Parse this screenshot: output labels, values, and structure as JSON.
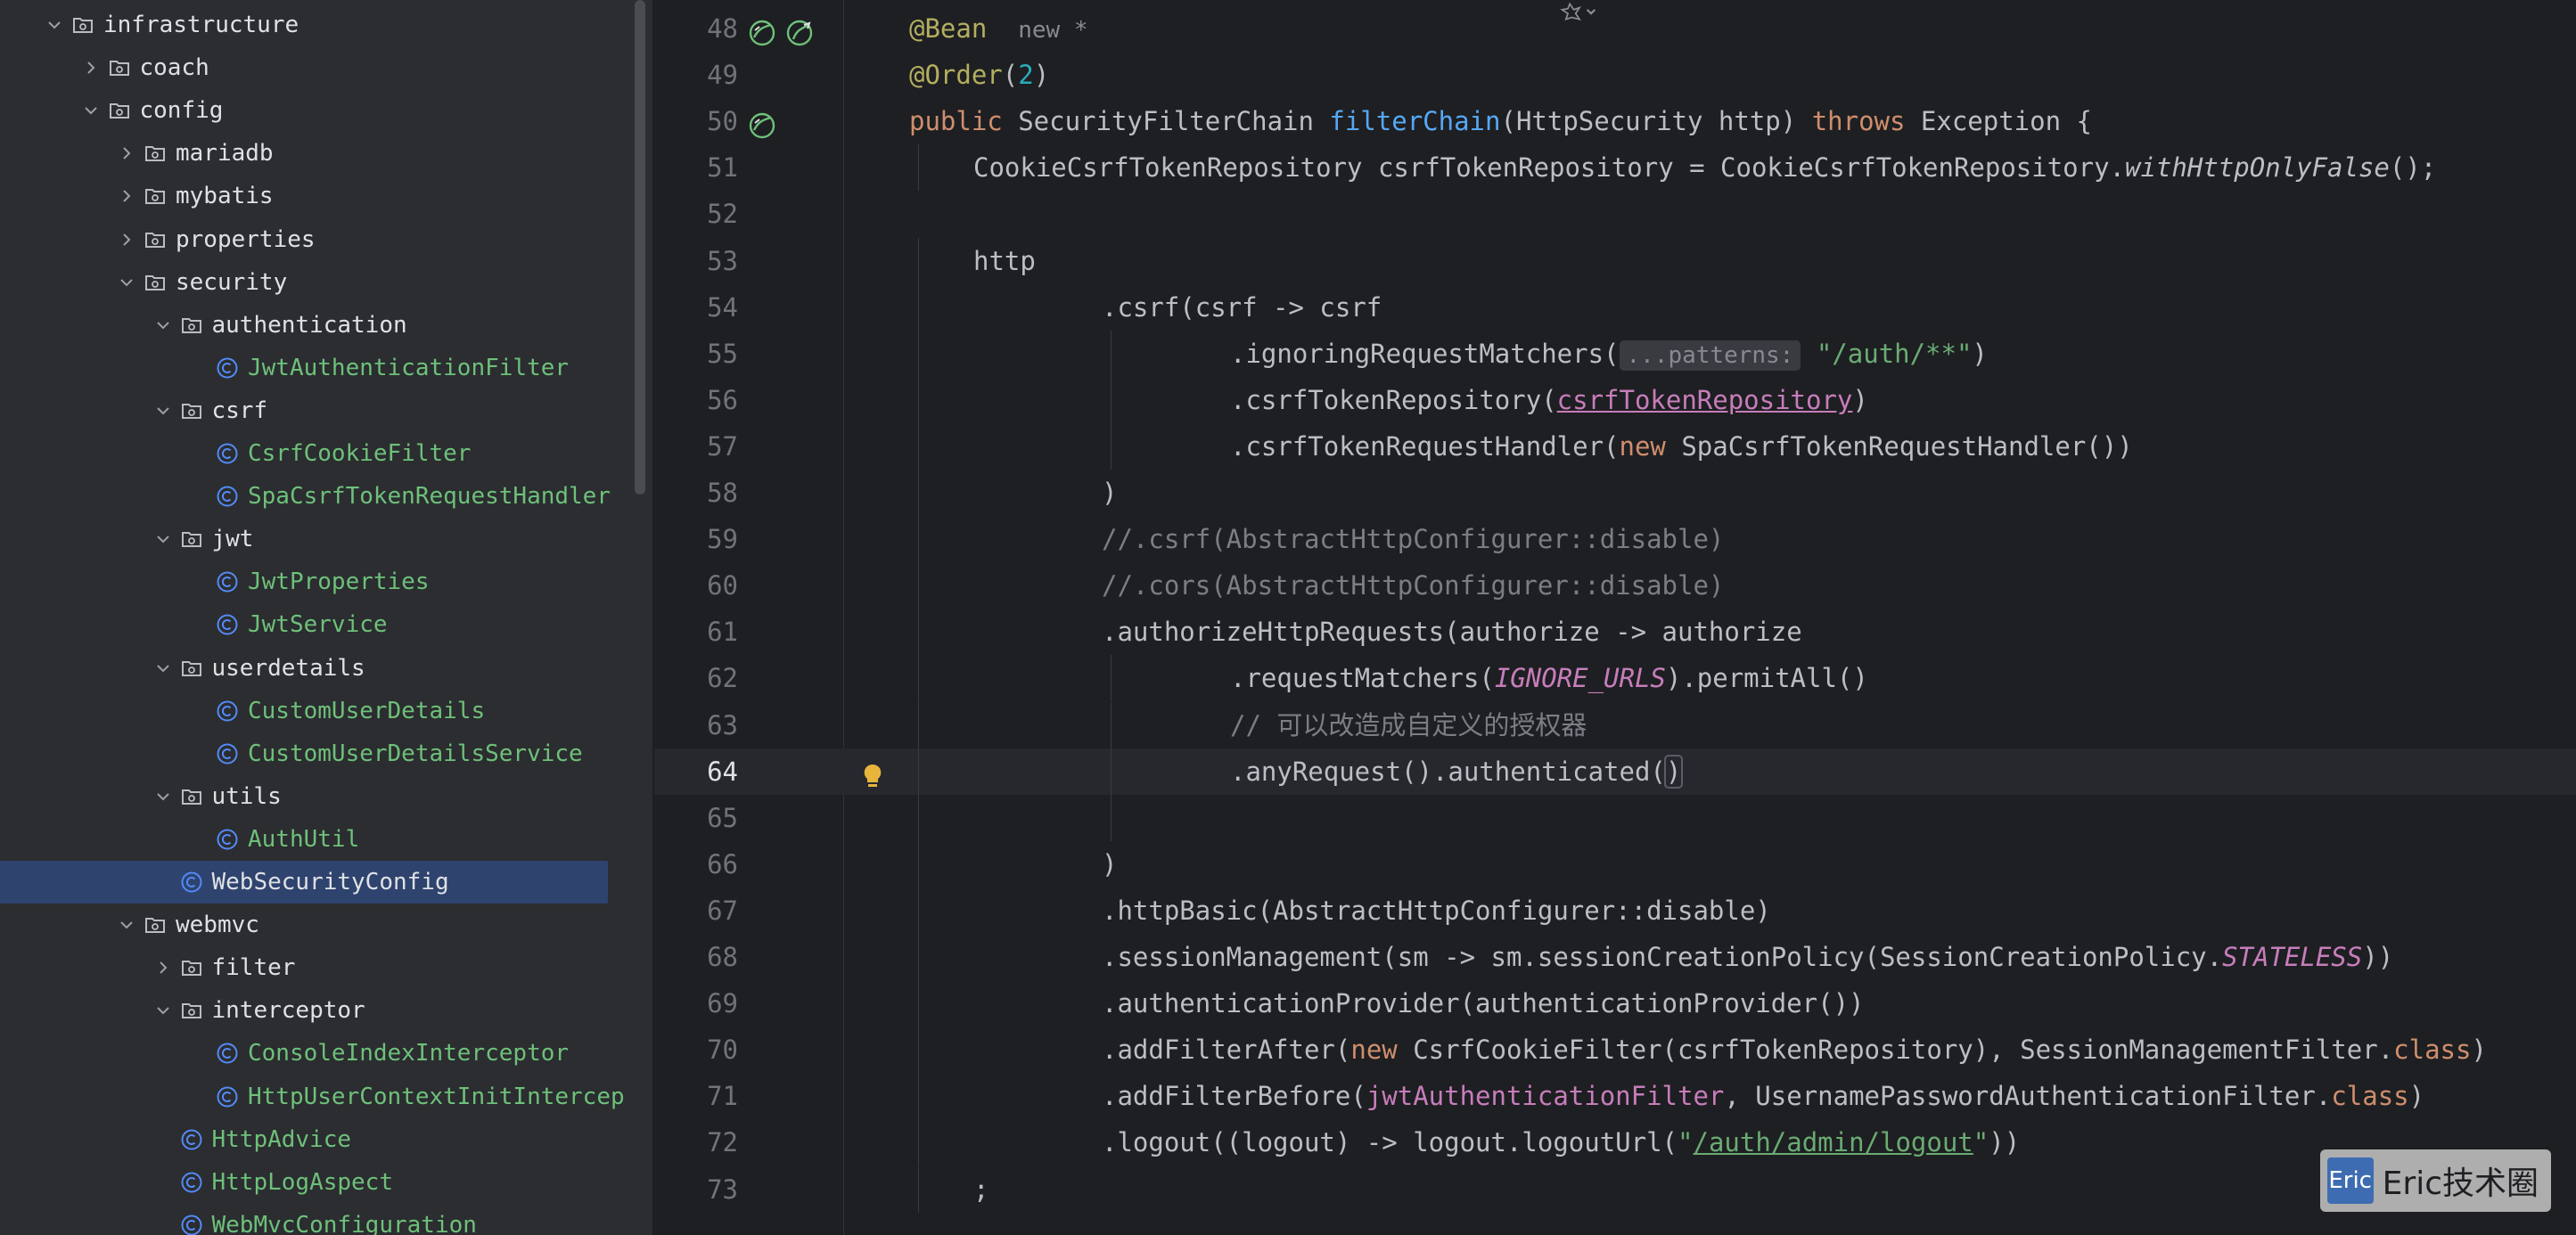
{
  "tree": [
    {
      "label": "infrastructure",
      "type": "folder",
      "depth": 0,
      "expanded": true
    },
    {
      "label": "coach",
      "type": "folder",
      "depth": 1,
      "expanded": false
    },
    {
      "label": "config",
      "type": "folder",
      "depth": 1,
      "expanded": true
    },
    {
      "label": "mariadb",
      "type": "folder",
      "depth": 2,
      "expanded": false
    },
    {
      "label": "mybatis",
      "type": "folder",
      "depth": 2,
      "expanded": false
    },
    {
      "label": "properties",
      "type": "folder",
      "depth": 2,
      "expanded": false
    },
    {
      "label": "security",
      "type": "folder",
      "depth": 2,
      "expanded": true
    },
    {
      "label": "authentication",
      "type": "folder",
      "depth": 3,
      "expanded": true
    },
    {
      "label": "JwtAuthenticationFilter",
      "type": "class",
      "depth": 4
    },
    {
      "label": "csrf",
      "type": "folder",
      "depth": 3,
      "expanded": true
    },
    {
      "label": "CsrfCookieFilter",
      "type": "class",
      "depth": 4
    },
    {
      "label": "SpaCsrfTokenRequestHandler",
      "type": "class",
      "depth": 4
    },
    {
      "label": "jwt",
      "type": "folder",
      "depth": 3,
      "expanded": true
    },
    {
      "label": "JwtProperties",
      "type": "class",
      "depth": 4
    },
    {
      "label": "JwtService",
      "type": "class",
      "depth": 4
    },
    {
      "label": "userdetails",
      "type": "folder",
      "depth": 3,
      "expanded": true
    },
    {
      "label": "CustomUserDetails",
      "type": "class",
      "depth": 4
    },
    {
      "label": "CustomUserDetailsService",
      "type": "class",
      "depth": 4
    },
    {
      "label": "utils",
      "type": "folder",
      "depth": 3,
      "expanded": true
    },
    {
      "label": "AuthUtil",
      "type": "class",
      "depth": 4
    },
    {
      "label": "WebSecurityConfig",
      "type": "class",
      "depth": 3,
      "selected": true
    },
    {
      "label": "webmvc",
      "type": "folder",
      "depth": 2,
      "expanded": true
    },
    {
      "label": "filter",
      "type": "folder",
      "depth": 3,
      "expanded": false
    },
    {
      "label": "interceptor",
      "type": "folder",
      "depth": 3,
      "expanded": true
    },
    {
      "label": "ConsoleIndexInterceptor",
      "type": "class",
      "depth": 4
    },
    {
      "label": "HttpUserContextInitIntercep",
      "type": "class",
      "depth": 4
    },
    {
      "label": "HttpAdvice",
      "type": "class",
      "depth": 3
    },
    {
      "label": "HttpLogAspect",
      "type": "class",
      "depth": 3
    },
    {
      "label": "WebMvcConfiguration",
      "type": "class",
      "depth": 3
    }
  ],
  "editor": {
    "current_line": "64",
    "lines": [
      {
        "n": "48",
        "indent": 0,
        "markers": [
          "bean-icon",
          "bean-override-icon"
        ],
        "tokens": [
          [
            "ann",
            "@Bean"
          ],
          [
            "plain",
            "  "
          ],
          [
            "hint",
            "new *"
          ]
        ]
      },
      {
        "n": "49",
        "indent": 0,
        "tokens": [
          [
            "ann",
            "@Order"
          ],
          [
            "plain",
            "("
          ],
          [
            "num",
            "2"
          ],
          [
            "plain",
            ")"
          ]
        ]
      },
      {
        "n": "50",
        "indent": 0,
        "markers": [
          "bean-icon"
        ],
        "tokens": [
          [
            "k",
            "public "
          ],
          [
            "plain",
            "SecurityFilterChain "
          ],
          [
            "fn",
            "filterChain"
          ],
          [
            "plain",
            "(HttpSecurity http) "
          ],
          [
            "k",
            "throws "
          ],
          [
            "plain",
            "Exception {"
          ]
        ]
      },
      {
        "n": "51",
        "indent": 1,
        "tokens": [
          [
            "plain",
            "CookieCsrfTokenRepository csrfTokenRepository = CookieCsrfTokenRepository."
          ],
          [
            "it",
            "withHttpOnlyFalse"
          ],
          [
            "plain",
            "();"
          ]
        ]
      },
      {
        "n": "52",
        "indent": 0,
        "tokens": []
      },
      {
        "n": "53",
        "indent": 1,
        "tokens": [
          [
            "plain",
            "http"
          ]
        ]
      },
      {
        "n": "54",
        "indent": 3,
        "tokens": [
          [
            "plain",
            ".csrf(csrf -> csrf"
          ]
        ]
      },
      {
        "n": "55",
        "indent": 5,
        "tokens": [
          [
            "plain",
            ".ignoringRequestMatchers("
          ],
          [
            "hintbox",
            "...patterns:"
          ],
          [
            "plain",
            " "
          ],
          [
            "str",
            "\"/auth/**\""
          ],
          [
            "plain",
            ")"
          ]
        ]
      },
      {
        "n": "56",
        "indent": 5,
        "tokens": [
          [
            "plain",
            ".csrfTokenRepository("
          ],
          [
            "fieldul",
            "csrfTokenRepository"
          ],
          [
            "plain",
            ")"
          ]
        ]
      },
      {
        "n": "57",
        "indent": 5,
        "tokens": [
          [
            "plain",
            ".csrfTokenRequestHandler("
          ],
          [
            "k",
            "new "
          ],
          [
            "plain",
            "SpaCsrfTokenRequestHandler())"
          ]
        ]
      },
      {
        "n": "58",
        "indent": 3,
        "tokens": [
          [
            "plain",
            ")"
          ]
        ]
      },
      {
        "n": "59",
        "indent": 3,
        "tokens": [
          [
            "cmt",
            "//.csrf(AbstractHttpConfigurer::disable)"
          ]
        ]
      },
      {
        "n": "60",
        "indent": 3,
        "tokens": [
          [
            "cmt",
            "//.cors(AbstractHttpConfigurer::disable)"
          ]
        ]
      },
      {
        "n": "61",
        "indent": 3,
        "tokens": [
          [
            "plain",
            ".authorizeHttpRequests(authorize -> authorize"
          ]
        ]
      },
      {
        "n": "62",
        "indent": 5,
        "tokens": [
          [
            "plain",
            ".requestMatchers("
          ],
          [
            "const",
            "IGNORE_URLS"
          ],
          [
            "plain",
            ").permitAll()"
          ]
        ]
      },
      {
        "n": "63",
        "indent": 5,
        "tokens": [
          [
            "cmt",
            "// 可以改造成自定义的授权器"
          ]
        ]
      },
      {
        "n": "64",
        "indent": 5,
        "markers": [
          "lightbulb-icon"
        ],
        "tokens": [
          [
            "plain",
            ".anyRequest().authenticated("
          ],
          [
            "brace",
            ")"
          ]
        ]
      },
      {
        "n": "65",
        "indent": 0,
        "tokens": []
      },
      {
        "n": "66",
        "indent": 3,
        "tokens": [
          [
            "plain",
            ")"
          ]
        ]
      },
      {
        "n": "67",
        "indent": 3,
        "tokens": [
          [
            "plain",
            ".httpBasic(AbstractHttpConfigurer::disable)"
          ]
        ]
      },
      {
        "n": "68",
        "indent": 3,
        "tokens": [
          [
            "plain",
            ".sessionManagement(sm -> sm.sessionCreationPolicy(SessionCreationPolicy."
          ],
          [
            "const",
            "STATELESS"
          ],
          [
            "plain",
            "))"
          ]
        ]
      },
      {
        "n": "69",
        "indent": 3,
        "tokens": [
          [
            "plain",
            ".authenticationProvider(authenticationProvider())"
          ]
        ]
      },
      {
        "n": "70",
        "indent": 3,
        "tokens": [
          [
            "plain",
            ".addFilterAfter("
          ],
          [
            "k",
            "new "
          ],
          [
            "plain",
            "CsrfCookieFilter(csrfTokenRepository), SessionManagementFilter."
          ],
          [
            "k",
            "class"
          ],
          [
            "plain",
            ")"
          ]
        ]
      },
      {
        "n": "71",
        "indent": 3,
        "tokens": [
          [
            "plain",
            ".addFilterBefore("
          ],
          [
            "field",
            "jwtAuthenticationFilter"
          ],
          [
            "plain",
            ", UsernamePasswordAuthenticationFilter."
          ],
          [
            "k",
            "class"
          ],
          [
            "plain",
            ")"
          ]
        ]
      },
      {
        "n": "72",
        "indent": 3,
        "tokens": [
          [
            "plain",
            ".logout((logout) -> logout.logoutUrl("
          ],
          [
            "str",
            "\""
          ],
          [
            "strul",
            "/auth/admin/logout"
          ],
          [
            "str",
            "\""
          ],
          [
            "plain",
            "))"
          ]
        ]
      },
      {
        "n": "73",
        "indent": 1,
        "tokens": [
          [
            "plain",
            ";"
          ]
        ]
      }
    ]
  },
  "watermark": {
    "logo": "Eric",
    "text": "Eric技术圈"
  },
  "colors": {
    "selection": "#2e436e",
    "class_label": "#6ec07a",
    "keyword": "#cf8e6d",
    "annotation": "#b3ae60",
    "function": "#56a8f5",
    "string": "#6aab73",
    "comment": "#7a7e85",
    "constant": "#c77dbb"
  }
}
